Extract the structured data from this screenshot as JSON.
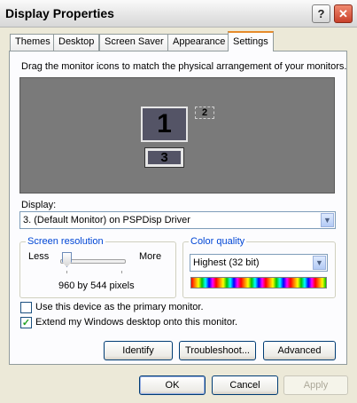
{
  "window": {
    "title": "Display Properties",
    "help": "?",
    "close": "✕"
  },
  "tabs": [
    {
      "label": "Themes"
    },
    {
      "label": "Desktop"
    },
    {
      "label": "Screen Saver"
    },
    {
      "label": "Appearance"
    },
    {
      "label": "Settings",
      "active": true
    }
  ],
  "settings": {
    "instruction": "Drag the monitor icons to match the physical arrangement of your monitors.",
    "monitors": [
      {
        "number": "1",
        "selected": false
      },
      {
        "number": "2",
        "selected": false
      },
      {
        "number": "3",
        "selected": true
      }
    ],
    "display_label": "Display:",
    "display_value": "3. (Default Monitor) on PSPDisp Driver",
    "resolution": {
      "title": "Screen resolution",
      "less": "Less",
      "more": "More",
      "value_text": "960 by 544 pixels",
      "slider_fraction": 0.05
    },
    "color_quality": {
      "title": "Color quality",
      "value": "Highest (32 bit)"
    },
    "primary_check": {
      "label": "Use this device as the primary monitor.",
      "checked": false
    },
    "extend_check": {
      "label": "Extend my Windows desktop onto this monitor.",
      "checked": true,
      "mark": "✓"
    },
    "buttons": {
      "identify": "Identify",
      "troubleshoot": "Troubleshoot...",
      "advanced": "Advanced"
    }
  },
  "footer": {
    "ok": "OK",
    "cancel": "Cancel",
    "apply": "Apply"
  }
}
